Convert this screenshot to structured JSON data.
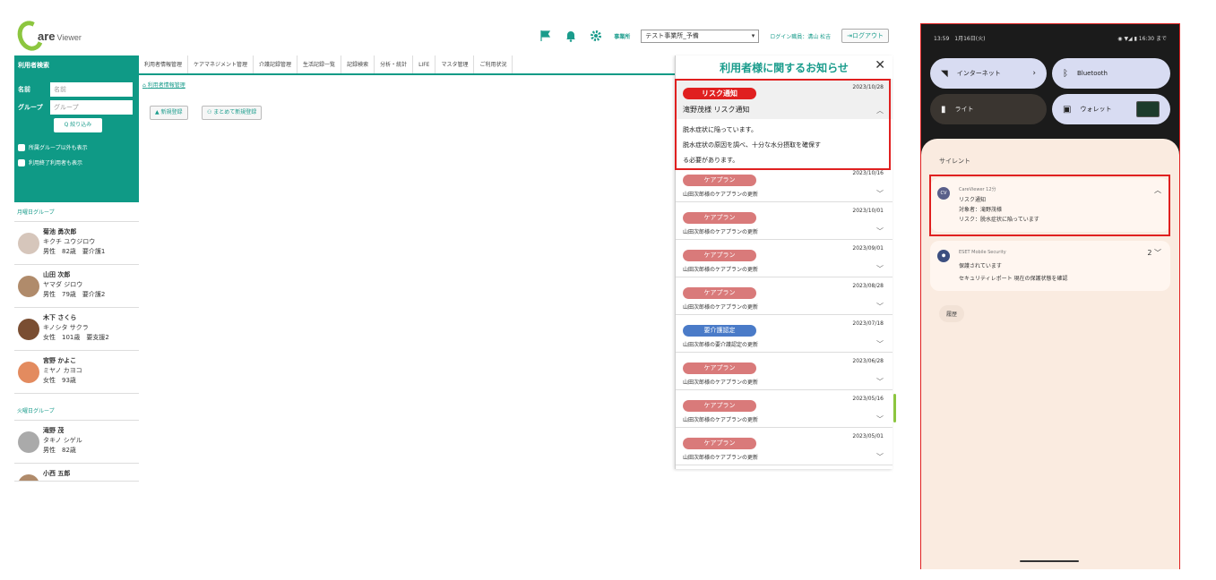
{
  "app": {
    "logo_main": "are",
    "logo_sub": "Viewer"
  },
  "topbar": {
    "office_label": "事業所",
    "office_value": "テスト事業所_予備",
    "login_label": "ログイン職員：溝山 松吉",
    "logout_label": "ログアウト"
  },
  "sidebar": {
    "header": "利用者検索",
    "name_label": "名前",
    "name_placeholder": "名前",
    "group_label": "グループ",
    "group_placeholder": "グループ",
    "filter_button": "Q 絞り込み",
    "check1": "所属グループ以外も表示",
    "check2": "利用終了利用者も表示",
    "groups": [
      {
        "name": "月曜日グループ",
        "users": [
          {
            "name": "菊池 勇次郎",
            "kana": "キクチ ユウジロウ",
            "info": "男性　82歳　要介護1"
          },
          {
            "name": "山田 次郎",
            "kana": "ヤマダ ジロウ",
            "info": "男性　79歳　要介護2"
          },
          {
            "name": "木下 さくら",
            "kana": "キノシタ サクラ",
            "info": "女性　101歳　要支援2"
          },
          {
            "name": "宮野 かよこ",
            "kana": "ミヤノ カヨコ",
            "info": "女性　93歳"
          }
        ]
      },
      {
        "name": "火曜日グループ",
        "users": [
          {
            "name": "滝野 茂",
            "kana": "タキノ シゲル",
            "info": "男性　82歳"
          },
          {
            "name": "小西 五郎",
            "kana": "",
            "info": ""
          }
        ]
      }
    ]
  },
  "nav": {
    "tabs": [
      "利用者情報管理",
      "ケアマネジメント管理",
      "介護記録管理",
      "生活記録一覧",
      "記録検索",
      "分析・統計",
      "LIFE",
      "マスタ管理",
      "ご利用状況"
    ],
    "breadcrumb": "利用者情報管理",
    "btn_new": "新規登録",
    "btn_bulk": "まとめて新規登録"
  },
  "notices": {
    "title": "利用者様に関するお知らせ",
    "first": {
      "badge": "リスク通知",
      "date": "2023/10/28",
      "subject": "滝野茂様 リスク通知",
      "body_lines": [
        "脱水症状に陥っています。",
        "脱水症状の原因を調べ、十分な水分摂取を確保す",
        "る必要があります。"
      ]
    },
    "items": [
      {
        "badge": "ケアプラン",
        "date": "2023/10/16",
        "text": "山田次郎様のケアプランの更新",
        "color": "#d97a7a"
      },
      {
        "badge": "ケアプラン",
        "date": "2023/10/01",
        "text": "山田次郎様のケアプランの更新",
        "color": "#d97a7a"
      },
      {
        "badge": "ケアプラン",
        "date": "2023/09/01",
        "text": "山田次郎様のケアプランの更新",
        "color": "#d97a7a"
      },
      {
        "badge": "ケアプラン",
        "date": "2023/08/28",
        "text": "山田次郎様のケアプランの更新",
        "color": "#d97a7a"
      },
      {
        "badge": "要介護認定",
        "date": "2023/07/18",
        "text": "山田次郎様の要介護認定の更新",
        "color": "#4a7bc8"
      },
      {
        "badge": "ケアプラン",
        "date": "2023/06/28",
        "text": "山田次郎様のケアプランの更新",
        "color": "#d97a7a"
      },
      {
        "badge": "ケアプラン",
        "date": "2023/05/16",
        "text": "山田次郎様のケアプランの更新",
        "color": "#d97a7a"
      },
      {
        "badge": "ケアプラン",
        "date": "2023/05/01",
        "text": "山田次郎様のケアプランの更新",
        "color": "#d97a7a"
      }
    ]
  },
  "phone": {
    "status_left": "13:59　1月16日(火)",
    "status_right": "16:30 まで",
    "tile_internet": "インターネット",
    "tile_bluetooth": "Bluetooth",
    "tile_light": "ライト",
    "tile_wallet": "ウォレット",
    "silent": "サイレント",
    "notif1": {
      "icon": "CV",
      "app": "CareViewer 12分",
      "line1": "リスク通知",
      "line2": "対象者：滝野茂様",
      "line3": "リスク：脱水症状に陥っています"
    },
    "notif2": {
      "app": "ESET Mobile Security",
      "count": "2",
      "line1": "保護されています",
      "line2": "セキュリティレポート 現在の保護状態を確認"
    },
    "history": "履歴"
  }
}
